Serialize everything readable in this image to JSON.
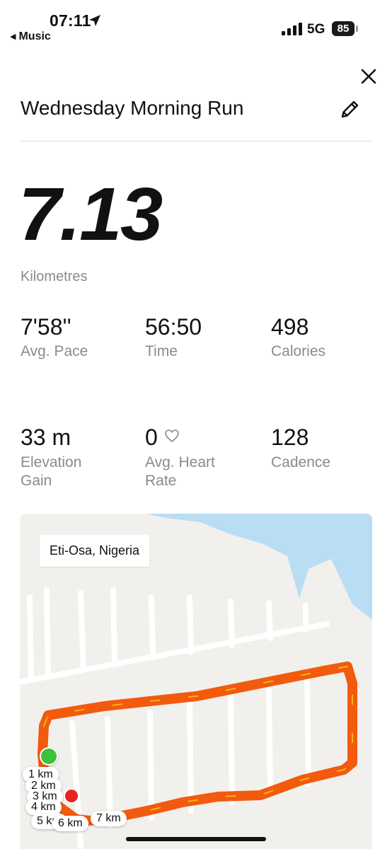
{
  "status_bar": {
    "time": "07:11",
    "back_app": "Music",
    "network": "5G",
    "battery": "85"
  },
  "header": {
    "title": "Wednesday Morning Run",
    "close_icon": "close-icon",
    "edit_icon": "pencil-icon"
  },
  "summary": {
    "distance": "7.13",
    "distance_unit": "Kilometres"
  },
  "stats": [
    {
      "value": "7'58''",
      "label": "Avg. Pace"
    },
    {
      "value": "56:50",
      "label": "Time"
    },
    {
      "value": "498",
      "label": "Calories"
    },
    {
      "value": "33 m",
      "label": "Elevation\nGain"
    },
    {
      "value": "0",
      "label": "Avg. Heart\nRate"
    },
    {
      "value": "128",
      "label": "Cadence"
    }
  ],
  "map": {
    "location": "Eti-Osa, Nigeria",
    "km_markers": [
      "1 km",
      "2 km",
      "3 km",
      "4 km",
      "5 km",
      "6 km",
      "7 km"
    ],
    "colors": {
      "route": "#f25a0e",
      "route_highlight": "#f7c51c",
      "water": "#b9ddf2",
      "land": "#f1f0ec",
      "start": "#3cc23a",
      "end": "#e8231e"
    }
  }
}
